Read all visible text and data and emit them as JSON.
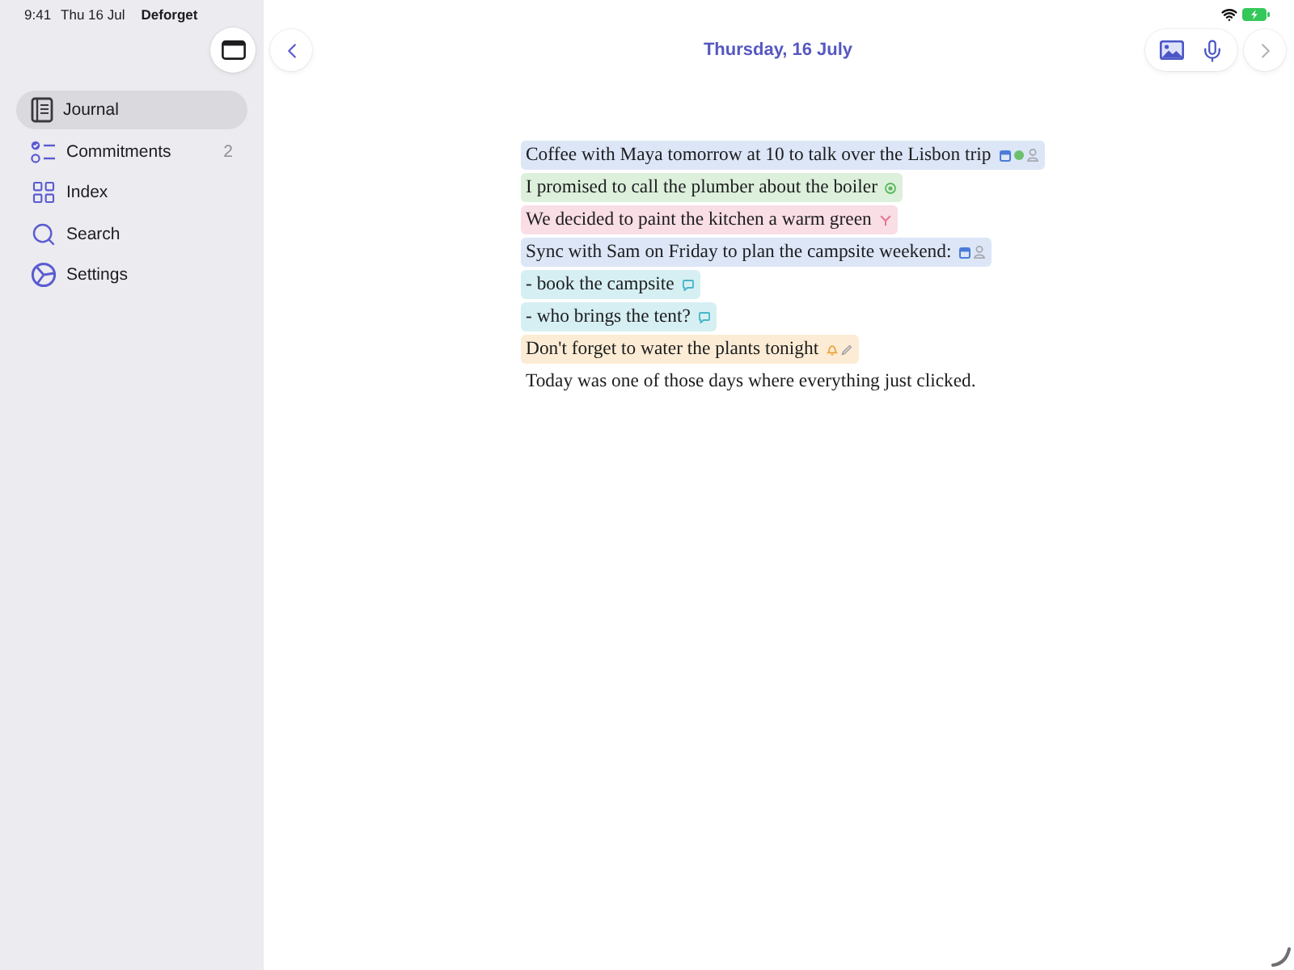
{
  "status_bar": {
    "time": "9:41",
    "date": "Thu 16 Jul",
    "app": "Deforget"
  },
  "sidebar": {
    "items": [
      {
        "kind": "journal",
        "label": "Journal",
        "selected": true
      },
      {
        "kind": "commitments",
        "label": "Commitments",
        "count": "2",
        "selected": false
      },
      {
        "kind": "index",
        "label": "Index",
        "selected": false
      },
      {
        "kind": "search",
        "label": "Search",
        "selected": false
      },
      {
        "kind": "settings",
        "label": "Settings",
        "selected": false
      }
    ]
  },
  "header": {
    "title": "Thursday, 16 July",
    "previous": {
      "disabled": false
    },
    "next": {
      "disabled": true
    }
  },
  "entries": [
    {
      "text": "Coffee with Maya tomorrow at 10 to talk over the Lisbon trip",
      "color": "#dce6f7",
      "tags": [
        {
          "kind": "calendar"
        },
        {
          "kind": "dot"
        },
        {
          "kind": "person"
        }
      ]
    },
    {
      "text": "I promised to call the plumber about the boiler",
      "color": "#dcf0dc",
      "tags": [
        {
          "kind": "commitment"
        }
      ]
    },
    {
      "text": "We decided to paint the kitchen a warm green",
      "color": "#f9dee5",
      "tags": [
        {
          "kind": "decision"
        }
      ]
    },
    {
      "text": "Sync with Sam on Friday to plan the campsite weekend:",
      "color": "#dce6f7",
      "tags": [
        {
          "kind": "calendar"
        },
        {
          "kind": "person"
        }
      ]
    },
    {
      "text": "- book the campsite",
      "color": "#d6eff3",
      "tags": [
        {
          "kind": "comment"
        }
      ]
    },
    {
      "text": "- who brings the tent?",
      "color": "#d6eff3",
      "tags": [
        {
          "kind": "comment"
        }
      ]
    },
    {
      "text": "Don't forget to water the plants tonight",
      "color": "#fcecd5",
      "tags": [
        {
          "kind": "reminder"
        },
        {
          "kind": "edit"
        }
      ]
    },
    {
      "text": "Today was one of those days where everything just clicked."
    }
  ]
}
